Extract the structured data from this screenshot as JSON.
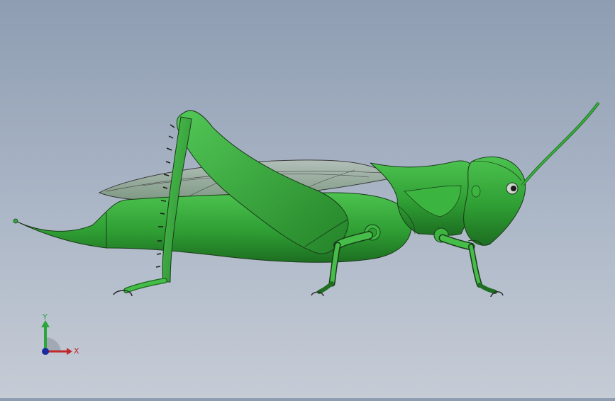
{
  "viewport": {
    "model": "grasshopper",
    "body_color": "#35a93a",
    "dark_color": "#1f6e22",
    "wing_color": "#8fa58c"
  },
  "triad": {
    "x_label": "X",
    "y_label": "Y",
    "x_color": "#c0282a",
    "y_color": "#2aa63a",
    "z_color": "#1a2aa0"
  }
}
